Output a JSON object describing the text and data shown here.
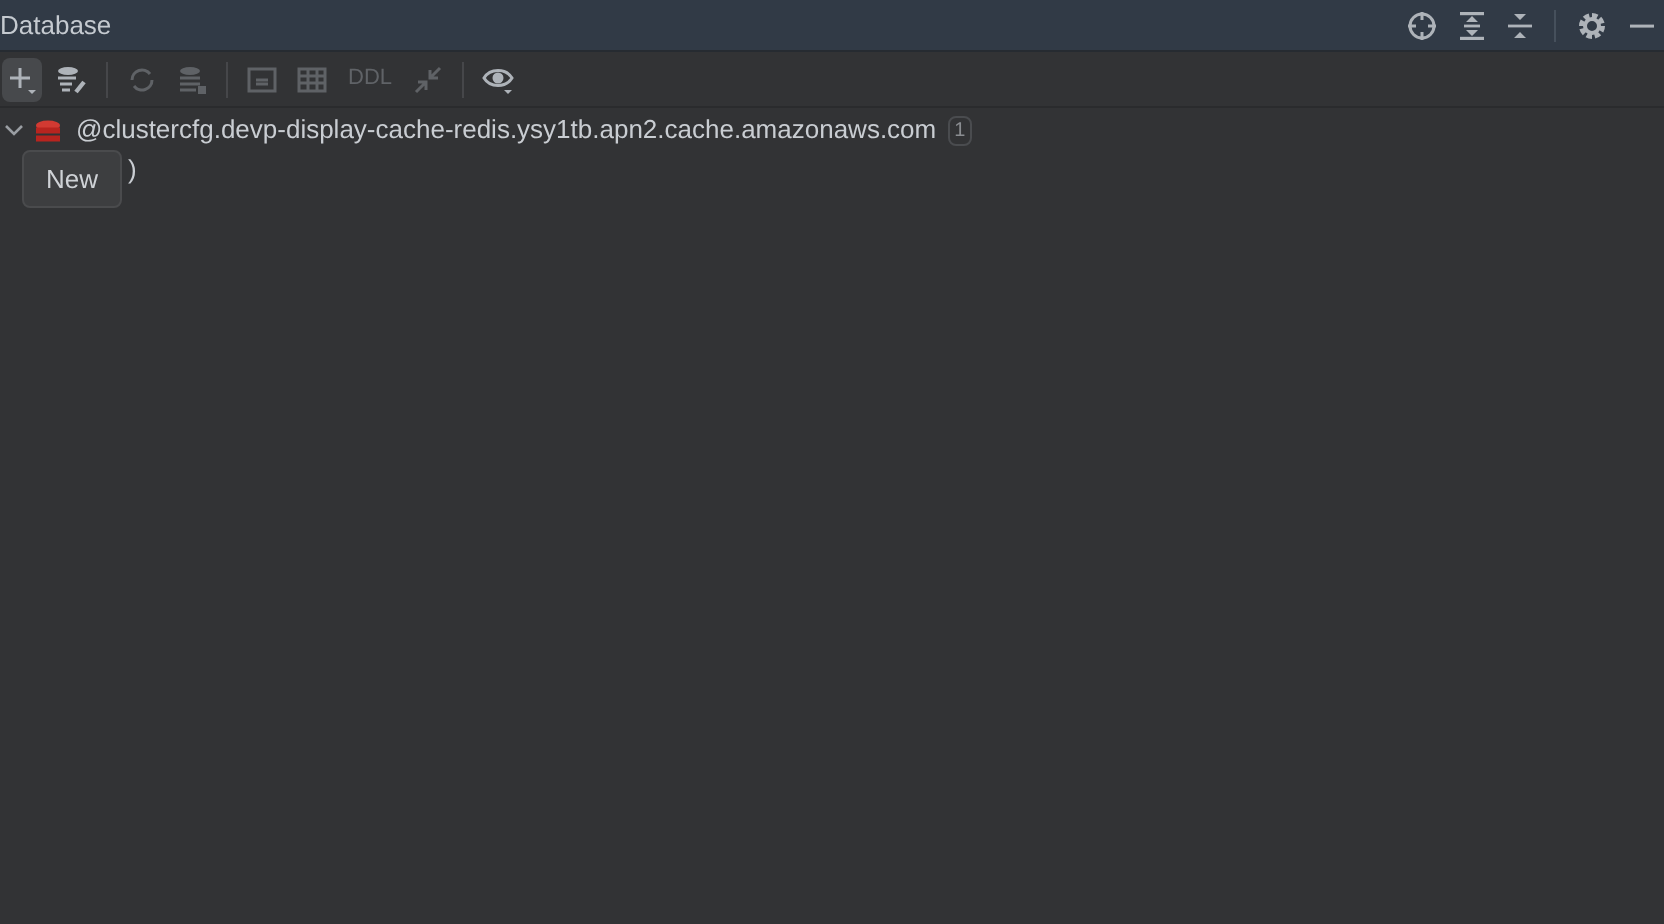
{
  "window": {
    "title": "Database"
  },
  "toolbar": [
    {
      "kind": "icon",
      "disabled": false
    },
    {
      "kind": "icon",
      "disabled": false
    },
    {
      "kind": "separator"
    },
    {
      "kind": "icon",
      "disabled": true
    },
    {
      "kind": "icon",
      "disabled": true
    },
    {
      "kind": "separator"
    },
    {
      "kind": "icon",
      "disabled": true
    },
    {
      "kind": "icon",
      "disabled": true
    },
    {
      "kind": "text",
      "label": "DDL",
      "disabled": true
    },
    {
      "kind": "icon",
      "disabled": true
    },
    {
      "kind": "separator"
    },
    {
      "kind": "icon",
      "disabled": false
    }
  ],
  "tree": [
    {
      "label": "@clustercfg.devp-display-cache-redis.ysy1tb.apn2.cache.amazonaws.com",
      "badge": "1",
      "expanded": true,
      "children": [
        {
          "label": ")"
        }
      ]
    }
  ],
  "tooltip": {
    "text": "New"
  }
}
